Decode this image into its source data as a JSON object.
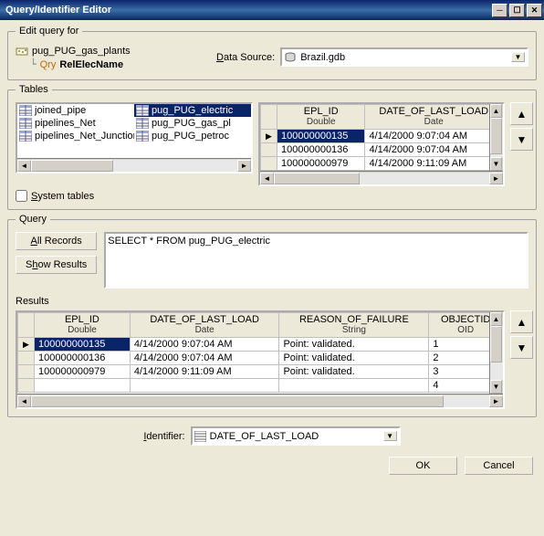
{
  "window": {
    "title": "Query/Identifier Editor"
  },
  "edit_query": {
    "legend": "Edit query for",
    "layer": "pug_PUG_gas_plants",
    "sub_prefix": "Qry",
    "sub_name": "RelElecName",
    "data_source_label": "Data Source:",
    "data_source_value": "Brazil.gdb"
  },
  "tables": {
    "legend": "Tables",
    "left_col": [
      "joined_pipe",
      "pipelines_Net",
      "pipelines_Net_Junctions"
    ],
    "right_col": [
      "pug_PUG_electric",
      "pug_PUG_gas_pl",
      "pug_PUG_petroc"
    ],
    "selected": "pug_PUG_electric",
    "system_tables_label": "System tables",
    "preview": {
      "cols": [
        {
          "name": "EPL_ID",
          "sub": "Double"
        },
        {
          "name": "DATE_OF_LAST_LOAD",
          "sub": "Date"
        }
      ],
      "rows": [
        {
          "id": "100000000135",
          "date": "4/14/2000 9:07:04 AM",
          "selected": true
        },
        {
          "id": "100000000136",
          "date": "4/14/2000 9:07:04 AM"
        },
        {
          "id": "100000000979",
          "date": "4/14/2000 9:11:09 AM"
        }
      ]
    }
  },
  "query": {
    "legend": "Query",
    "all_records": "All Records",
    "show_results": "Show Results",
    "sql": "SELECT * FROM pug_PUG_electric"
  },
  "results": {
    "label": "Results",
    "cols": [
      {
        "name": "EPL_ID",
        "sub": "Double"
      },
      {
        "name": "DATE_OF_LAST_LOAD",
        "sub": "Date"
      },
      {
        "name": "REASON_OF_FAILURE",
        "sub": "String"
      },
      {
        "name": "OBJECTID",
        "sub": "OID"
      }
    ],
    "rows": [
      {
        "id": "100000000135",
        "date": "4/14/2000 9:07:04 AM",
        "reason": "Point: validated.",
        "oid": "1",
        "selected": true
      },
      {
        "id": "100000000136",
        "date": "4/14/2000 9:07:04 AM",
        "reason": "Point: validated.",
        "oid": "2"
      },
      {
        "id": "100000000979",
        "date": "4/14/2000 9:11:09 AM",
        "reason": "Point: validated.",
        "oid": "3"
      },
      {
        "id": "",
        "date": "",
        "reason": "",
        "oid": "4"
      }
    ]
  },
  "identifier": {
    "label": "Identifier:",
    "value": "DATE_OF_LAST_LOAD"
  },
  "buttons": {
    "ok": "OK",
    "cancel": "Cancel"
  }
}
